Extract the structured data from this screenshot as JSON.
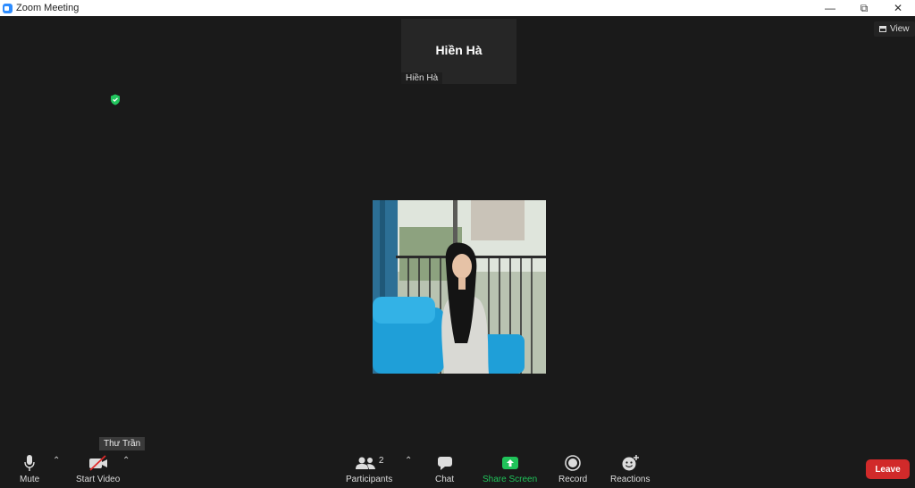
{
  "window": {
    "title": "Zoom Meeting"
  },
  "view_button": {
    "label": "View"
  },
  "participant_tile": {
    "display_name": "Hiền Hà",
    "name_label": "Hiền Hà"
  },
  "tooltip": {
    "text": "Thư Trần"
  },
  "toolbar": {
    "mute": "Mute",
    "start_video": "Start Video",
    "participants": "Participants",
    "participants_count": "2",
    "chat": "Chat",
    "share_screen": "Share Screen",
    "record": "Record",
    "reactions": "Reactions",
    "leave": "Leave"
  },
  "colors": {
    "background": "#1a1a1a",
    "share_green": "#20c35a",
    "leave_red": "#d12a2a",
    "security_green": "#22c55e"
  }
}
